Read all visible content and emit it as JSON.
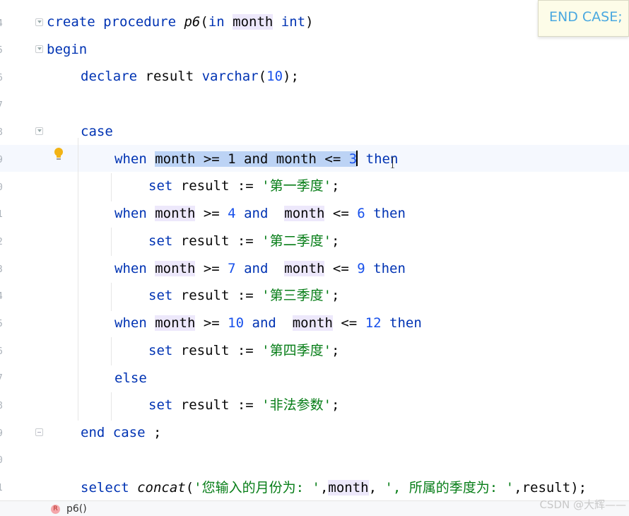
{
  "editor": {
    "line_numbers": [
      "4",
      "5",
      "6",
      "7",
      "8",
      "9",
      "0",
      "1",
      "2",
      "3",
      "4",
      "5",
      "6",
      "7",
      "8",
      "9",
      "0",
      "1"
    ],
    "lines": {
      "l1": {
        "kw1": "create procedure ",
        "name": "p6",
        "p1": "(",
        "kw2": "in ",
        "var": "month",
        "sp": " ",
        "kw3": "int",
        "p2": ")"
      },
      "l2": {
        "kw": "begin"
      },
      "l3": {
        "kw1": "declare ",
        "var": "result ",
        "kw2": "varchar",
        "p1": "(",
        "num": "10",
        "p2": ");"
      },
      "l4": {
        "kw": "case"
      },
      "l5": {
        "kw": "when ",
        "sel": "month >= 1 and month <= ",
        "selnum": "3",
        "then": "then"
      },
      "l6": {
        "kw": "set ",
        "mid": "result := ",
        "str": "'第一季度'",
        "end": ";"
      },
      "l7": {
        "kw": "when ",
        "var": "month",
        "op1": " >= ",
        "num1": "4",
        "and": " and ",
        "var2": "month",
        "op2": " <= ",
        "num2": "6",
        "then": " then"
      },
      "l8": {
        "kw": "set ",
        "mid": "result := ",
        "str": "'第二季度'",
        "end": ";"
      },
      "l9": {
        "kw": "when ",
        "var": "month",
        "op1": " >= ",
        "num1": "7",
        "and": " and ",
        "var2": "month",
        "op2": " <= ",
        "num2": "9",
        "then": " then"
      },
      "l10": {
        "kw": "set ",
        "mid": "result := ",
        "str": "'第三季度'",
        "end": ";"
      },
      "l11": {
        "kw": "when ",
        "var": "month",
        "op1": " >= ",
        "num1": "10",
        "and": " and ",
        "var2": "month",
        "op2": " <= ",
        "num2": "12",
        "then": " then"
      },
      "l12": {
        "kw": "set ",
        "mid": "result := ",
        "str": "'第四季度'",
        "end": ";"
      },
      "l13": {
        "kw": "else"
      },
      "l14": {
        "kw": "set ",
        "mid": "result := ",
        "str": "'非法参数'",
        "end": ";"
      },
      "l15": {
        "kw": "end case ",
        "end": ";"
      },
      "l16": {
        "kw": "select ",
        "fn": "concat",
        "p1": "(",
        "str1": "'您输入的月份为: '",
        "c1": ",",
        "var": "month",
        "c2": ", ",
        "str2": "', 所属的季度为: '",
        "c3": ",result);"
      }
    }
  },
  "popup": {
    "text": "END CASE;"
  },
  "status_bar": {
    "badge": "R",
    "procedure": "p6()"
  },
  "watermark": "CSDN @大辉——",
  "colors": {
    "keyword": "#0033b3",
    "number": "#1750eb",
    "string": "#067d17",
    "selection": "#bcd3f5",
    "usage_highlight": "#ede8fb"
  }
}
